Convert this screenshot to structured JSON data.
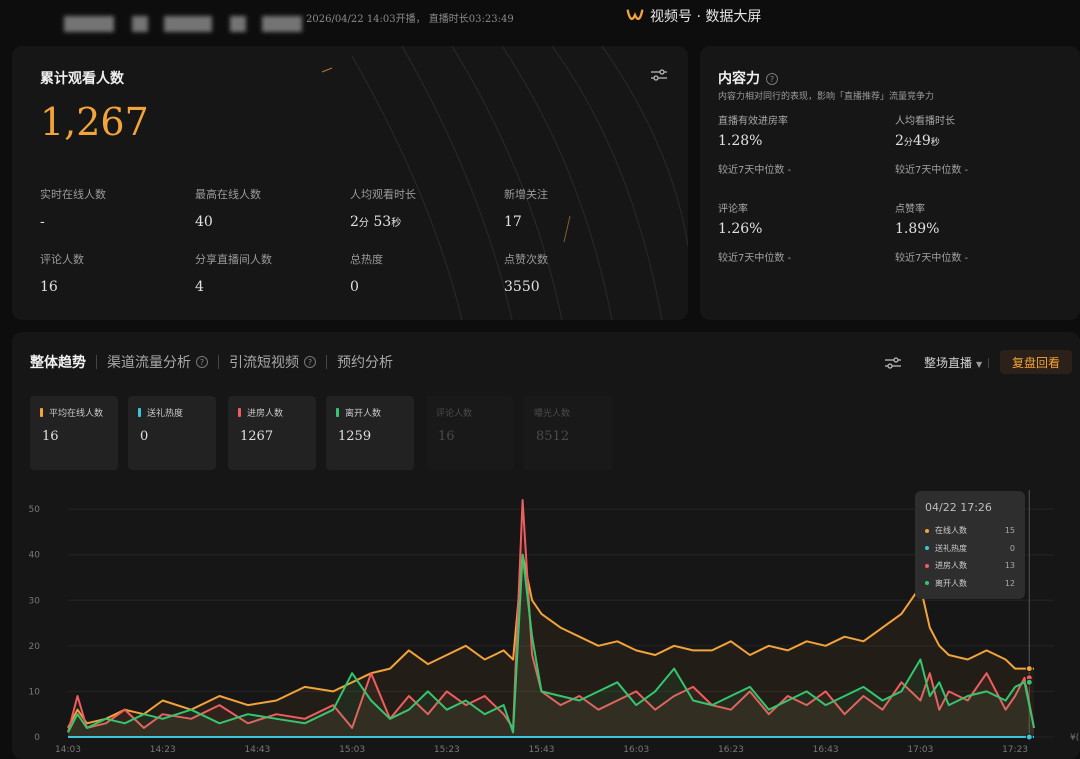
{
  "header": {
    "start_info": "2026/04/22 14:03开播， 直播时长03:23:49",
    "brand": "视频号 · 数据大屏"
  },
  "overview": {
    "title": "累计观看人数",
    "total": "1,267",
    "stats": [
      {
        "label": "实时在线人数",
        "value": "-"
      },
      {
        "label": "最高在线人数",
        "value": "40"
      },
      {
        "label": "人均观看时长",
        "value_parts": [
          "2",
          "分",
          "53",
          "秒"
        ]
      },
      {
        "label": "新增关注",
        "value": "17"
      },
      {
        "label": "评论人数",
        "value": "16"
      },
      {
        "label": "分享直播间人数",
        "value": "4"
      },
      {
        "label": "总热度",
        "value": "0"
      },
      {
        "label": "点赞次数",
        "value": "3550"
      }
    ]
  },
  "content_power": {
    "title": "内容力",
    "desc": "内容力相对同行的表现，影响「直播推荐」流量竞争力",
    "stats": [
      {
        "label": "直播有效进房率",
        "value": "1.28%",
        "median": "较近7天中位数 -"
      },
      {
        "label": "人均看播时长",
        "value_parts": [
          "2",
          "分",
          "49",
          "秒"
        ],
        "median": "较近7天中位数 -"
      },
      {
        "label": "评论率",
        "value": "1.26%",
        "median": "较近7天中位数 -"
      },
      {
        "label": "点赞率",
        "value": "1.89%",
        "median": "较近7天中位数 -"
      }
    ]
  },
  "trend": {
    "tabs": [
      {
        "label": "整体趋势",
        "active": true,
        "help": false
      },
      {
        "label": "渠道流量分析",
        "active": false,
        "help": true
      },
      {
        "label": "引流短视频",
        "active": false,
        "help": true
      },
      {
        "label": "预约分析",
        "active": false,
        "help": false
      }
    ],
    "range_label": "整场直播",
    "review_label": "复盘回看",
    "metrics": [
      {
        "label": "平均在线人数",
        "value": "16",
        "color": "#f2a33a",
        "active": true
      },
      {
        "label": "送礼热度",
        "value": "0",
        "color": "#3ec6d8",
        "active": true
      },
      {
        "label": "进房人数",
        "value": "1267",
        "color": "#ee5e5e",
        "active": true
      },
      {
        "label": "离开人数",
        "value": "1259",
        "color": "#35c56e",
        "active": true
      },
      {
        "label": "评论人数",
        "value": "16",
        "color": "#555555",
        "active": false
      },
      {
        "label": "曝光人数",
        "value": "8512",
        "color": "#555555",
        "active": false
      }
    ],
    "tooltip": {
      "title": "04/22 17:26",
      "rows": [
        {
          "label": "在线人数",
          "value": "15",
          "color": "#f2a33a"
        },
        {
          "label": "送礼热度",
          "value": "0",
          "color": "#3ec6d8"
        },
        {
          "label": "进房人数",
          "value": "13",
          "color": "#ee5e5e"
        },
        {
          "label": "离开人数",
          "value": "12",
          "color": "#35c56e"
        }
      ]
    }
  },
  "chart_data": {
    "type": "line",
    "x_ticks": [
      "14:03",
      "14:23",
      "14:43",
      "15:03",
      "15:23",
      "15:43",
      "16:03",
      "16:23",
      "16:43",
      "17:03",
      "17:23"
    ],
    "x_tick_minutes": [
      0,
      20,
      40,
      60,
      80,
      100,
      120,
      140,
      160,
      180,
      200
    ],
    "x_end_label": "¥(",
    "y_ticks": [
      0,
      10,
      20,
      30,
      40,
      50
    ],
    "ylim": [
      0,
      52
    ],
    "xlim_minutes": [
      0,
      204
    ],
    "grid": true,
    "series": [
      {
        "name": "在线人数",
        "color": "#f2a33a",
        "minutes": [
          0,
          2,
          4,
          8,
          12,
          16,
          20,
          26,
          32,
          38,
          44,
          50,
          56,
          60,
          64,
          68,
          72,
          76,
          80,
          84,
          88,
          90,
          92,
          94,
          96,
          98,
          100,
          104,
          108,
          112,
          116,
          120,
          124,
          128,
          132,
          136,
          140,
          144,
          148,
          152,
          156,
          160,
          164,
          168,
          172,
          176,
          180,
          182,
          184,
          186,
          190,
          194,
          198,
          200,
          202,
          204
        ],
        "values": [
          2,
          6,
          3,
          4,
          6,
          5,
          8,
          6,
          9,
          7,
          8,
          11,
          10,
          12,
          14,
          15,
          19,
          16,
          18,
          20,
          17,
          18,
          19,
          17,
          40,
          30,
          27,
          24,
          22,
          20,
          21,
          19,
          18,
          20,
          19,
          19,
          21,
          18,
          20,
          19,
          21,
          20,
          22,
          21,
          24,
          27,
          33,
          24,
          20,
          18,
          17,
          19,
          17,
          15,
          15,
          15
        ]
      },
      {
        "name": "送礼热度",
        "color": "#3ec6d8",
        "minutes": [
          0,
          204
        ],
        "values": [
          0,
          0
        ]
      },
      {
        "name": "进房人数",
        "color": "#ee5e5e",
        "minutes": [
          0,
          2,
          4,
          8,
          12,
          16,
          20,
          26,
          32,
          38,
          44,
          50,
          56,
          60,
          64,
          68,
          72,
          76,
          80,
          84,
          88,
          92,
          94,
          96,
          98,
          100,
          104,
          108,
          112,
          116,
          120,
          124,
          128,
          132,
          136,
          140,
          144,
          148,
          152,
          156,
          160,
          164,
          168,
          172,
          176,
          180,
          182,
          184,
          186,
          190,
          194,
          198,
          200,
          202,
          204
        ],
        "values": [
          1,
          9,
          2,
          3,
          6,
          2,
          5,
          4,
          7,
          3,
          5,
          4,
          7,
          2,
          14,
          4,
          9,
          5,
          10,
          7,
          9,
          5,
          2,
          52,
          18,
          10,
          7,
          9,
          6,
          8,
          10,
          6,
          9,
          11,
          7,
          6,
          10,
          5,
          9,
          7,
          10,
          5,
          9,
          6,
          12,
          8,
          14,
          6,
          10,
          8,
          14,
          6,
          9,
          13,
          2
        ]
      },
      {
        "name": "离开人数",
        "color": "#35c56e",
        "minutes": [
          0,
          2,
          4,
          8,
          12,
          16,
          20,
          26,
          32,
          38,
          44,
          50,
          56,
          60,
          64,
          68,
          72,
          76,
          80,
          84,
          88,
          92,
          94,
          96,
          98,
          100,
          104,
          108,
          112,
          116,
          120,
          124,
          128,
          132,
          136,
          140,
          144,
          148,
          152,
          156,
          160,
          164,
          168,
          172,
          176,
          180,
          182,
          184,
          186,
          190,
          194,
          198,
          200,
          202,
          204
        ],
        "values": [
          1,
          5,
          2,
          4,
          3,
          5,
          4,
          6,
          3,
          5,
          4,
          3,
          6,
          14,
          8,
          4,
          6,
          10,
          6,
          8,
          5,
          7,
          1,
          40,
          22,
          10,
          9,
          8,
          10,
          12,
          7,
          10,
          15,
          8,
          7,
          9,
          11,
          6,
          8,
          10,
          7,
          9,
          11,
          8,
          10,
          17,
          9,
          12,
          7,
          9,
          10,
          8,
          11,
          12,
          2
        ]
      }
    ]
  }
}
